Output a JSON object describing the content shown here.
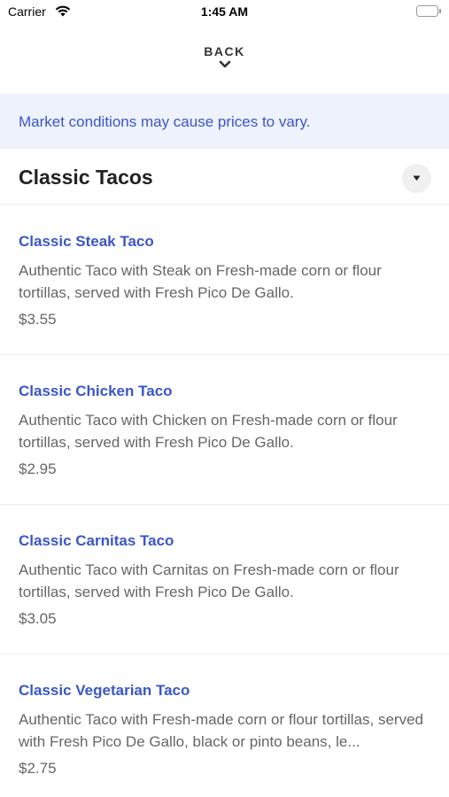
{
  "status_bar": {
    "carrier": "Carrier",
    "time": "1:45 AM"
  },
  "nav": {
    "back_label": "BACK"
  },
  "notice": {
    "text": "Market conditions may cause prices to vary."
  },
  "category": {
    "title": "Classic Tacos"
  },
  "items": [
    {
      "name": "Classic Steak Taco",
      "description": "Authentic Taco with Steak on Fresh-made corn or flour tortillas, served with Fresh Pico De Gallo.",
      "price": "$3.55"
    },
    {
      "name": "Classic Chicken Taco",
      "description": "Authentic Taco with Chicken on Fresh-made corn or flour tortillas, served with Fresh Pico De Gallo.",
      "price": "$2.95"
    },
    {
      "name": "Classic Carnitas Taco",
      "description": "Authentic Taco with Carnitas on Fresh-made corn or flour tortillas, served with Fresh Pico De Gallo.",
      "price": "$3.05"
    },
    {
      "name": "Classic Vegetarian Taco",
      "description": "Authentic Taco with Fresh-made corn or flour tortillas, served with Fresh Pico De Gallo, black or pinto beans, le...",
      "price": "$2.75"
    }
  ],
  "colors": {
    "accent": "#3a56c9",
    "notice_bg": "#eef2fc",
    "body_text": "#666666"
  },
  "icons": {
    "wifi": "wifi-icon",
    "battery": "battery-icon",
    "back": "chevron-down-icon",
    "toggle": "caret-down-icon"
  }
}
